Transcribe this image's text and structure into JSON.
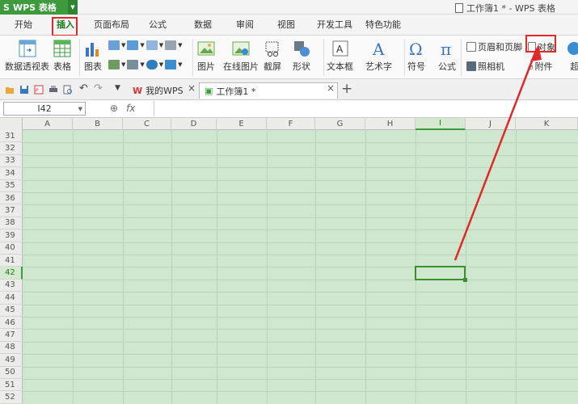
{
  "app": {
    "name": "WPS 表格",
    "window_title": "工作簿1 * - WPS 表格"
  },
  "menu": {
    "tabs": [
      "开始",
      "插入",
      "页面布局",
      "公式",
      "数据",
      "审阅",
      "视图",
      "开发工具",
      "特色功能"
    ],
    "active": "插入"
  },
  "ribbon": {
    "pivot_label": "数据透视表",
    "table_label": "表格",
    "chart_label": "图表",
    "picture_label": "图片",
    "online_picture_label": "在线图片",
    "screenshot_label": "截屏",
    "shapes_label": "形状",
    "textbox_label": "文本框",
    "wordart_label": "艺术字",
    "symbol_label": "符号",
    "formula_label": "公式",
    "header_footer_label": "页眉和页脚",
    "camera_label": "照相机",
    "object_label": "对象",
    "attachment_label": "附件",
    "more_label": "超"
  },
  "tabstrip": {
    "tabs": [
      {
        "label": "我的WPS",
        "active": false
      },
      {
        "label": "工作簿1 *",
        "active": true
      }
    ]
  },
  "formula_bar": {
    "cell_ref": "I42",
    "fx": "fx",
    "search": "Q",
    "value": ""
  },
  "sheet": {
    "columns": [
      "A",
      "B",
      "C",
      "D",
      "E",
      "F",
      "G",
      "H",
      "I",
      "J",
      "K"
    ],
    "selected_column": "I",
    "rows": [
      "31",
      "32",
      "33",
      "34",
      "35",
      "36",
      "37",
      "38",
      "39",
      "40",
      "41",
      "42",
      "43",
      "44",
      "45",
      "46",
      "47",
      "48",
      "49",
      "50",
      "51",
      "52"
    ],
    "selected_row": "42",
    "fill_color": "#cfe6cf"
  },
  "colors": {
    "accent_green": "#3d9a3d",
    "highlight_red": "#e02a2a"
  }
}
